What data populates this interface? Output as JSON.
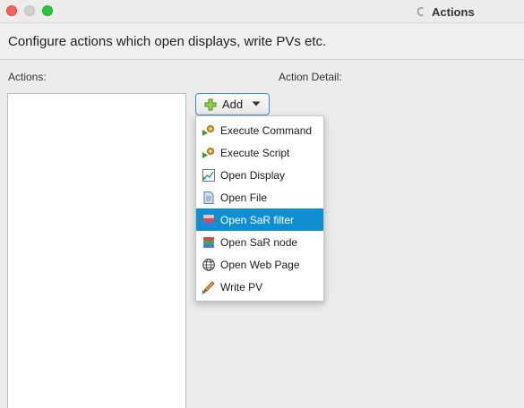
{
  "window": {
    "title": "Actions"
  },
  "header": {
    "text": "Configure actions which open displays, write PVs etc."
  },
  "labels": {
    "actions": "Actions:",
    "action_detail": "Action Detail:"
  },
  "add_button": {
    "label": "Add"
  },
  "menu": {
    "items": [
      {
        "label": "Execute Command",
        "icon": "gear-play-icon",
        "selected": false
      },
      {
        "label": "Execute Script",
        "icon": "gear-play-icon",
        "selected": false
      },
      {
        "label": "Open Display",
        "icon": "display-chart-icon",
        "selected": false
      },
      {
        "label": "Open File",
        "icon": "file-icon",
        "selected": false
      },
      {
        "label": "Open SaR filter",
        "icon": "sar-stack-icon",
        "selected": true
      },
      {
        "label": "Open SaR node",
        "icon": "sar-stack-icon",
        "selected": false
      },
      {
        "label": "Open Web Page",
        "icon": "globe-icon",
        "selected": false
      },
      {
        "label": "Write PV",
        "icon": "pencil-write-icon",
        "selected": false
      }
    ]
  },
  "colors": {
    "selection": "#0f8fd1",
    "close": "#fe5f57",
    "zoom": "#28c840",
    "focus_border": "#3d8fd4"
  }
}
